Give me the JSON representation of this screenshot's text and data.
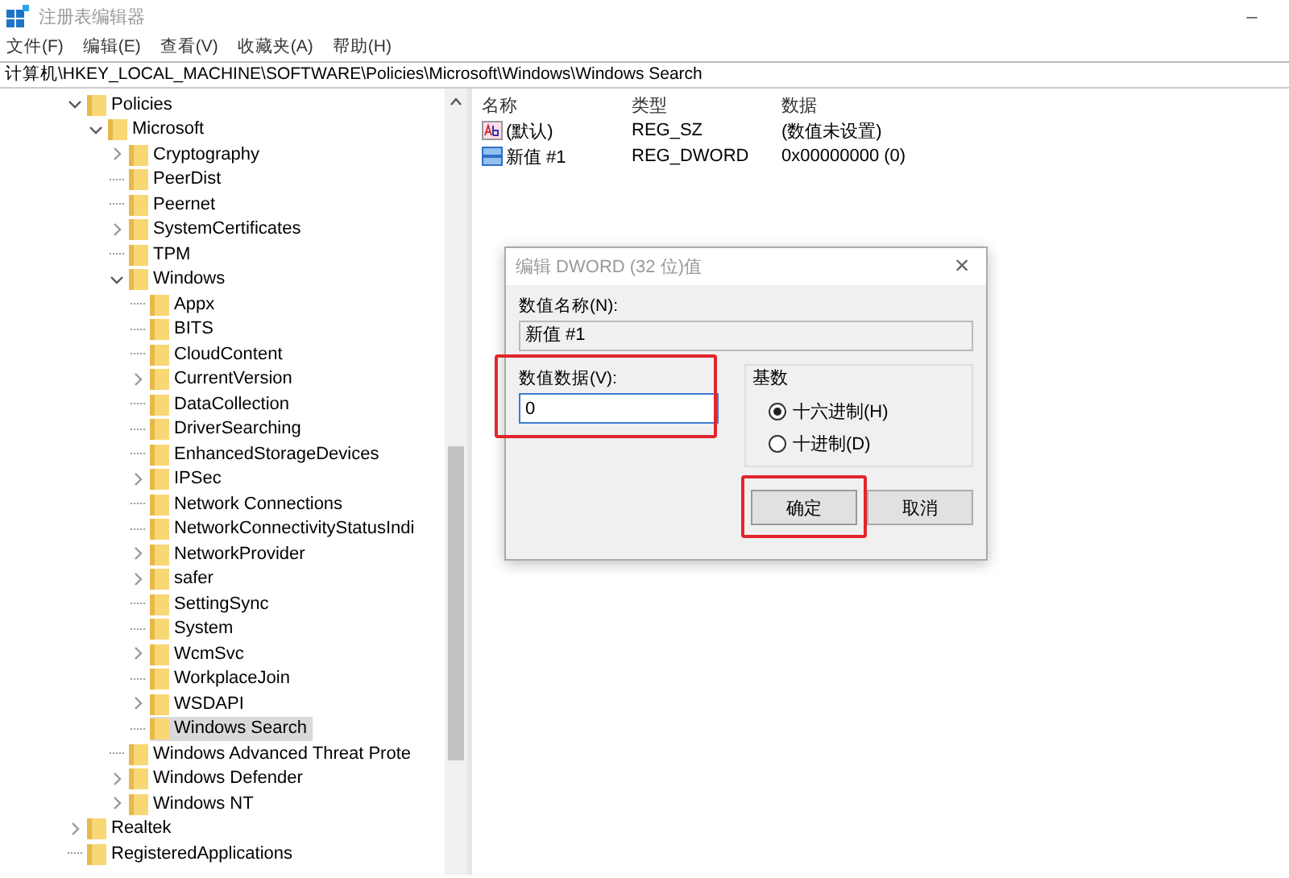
{
  "window": {
    "title": "注册表编辑器",
    "minimize": "–"
  },
  "menu": [
    "文件(F)",
    "编辑(E)",
    "查看(V)",
    "收藏夹(A)",
    "帮助(H)"
  ],
  "address": "计算机\\HKEY_LOCAL_MACHINE\\SOFTWARE\\Policies\\Microsoft\\Windows\\Windows Search",
  "tree": [
    {
      "label": "Policies",
      "kind": "branch",
      "expanded": true,
      "selected": false,
      "children": [
        {
          "label": "Microsoft",
          "kind": "branch",
          "expanded": true,
          "selected": false,
          "children": [
            {
              "label": "Cryptography",
              "kind": "branch",
              "expanded": false,
              "selected": false
            },
            {
              "label": "PeerDist",
              "kind": "leaf",
              "selected": false
            },
            {
              "label": "Peernet",
              "kind": "leaf",
              "selected": false
            },
            {
              "label": "SystemCertificates",
              "kind": "branch",
              "expanded": false,
              "selected": false
            },
            {
              "label": "TPM",
              "kind": "leaf",
              "selected": false
            },
            {
              "label": "Windows",
              "kind": "branch",
              "expanded": true,
              "selected": false,
              "children": [
                {
                  "label": "Appx",
                  "kind": "leaf",
                  "selected": false
                },
                {
                  "label": "BITS",
                  "kind": "leaf",
                  "selected": false
                },
                {
                  "label": "CloudContent",
                  "kind": "leaf",
                  "selected": false
                },
                {
                  "label": "CurrentVersion",
                  "kind": "branch",
                  "expanded": false,
                  "selected": false
                },
                {
                  "label": "DataCollection",
                  "kind": "leaf",
                  "selected": false
                },
                {
                  "label": "DriverSearching",
                  "kind": "leaf",
                  "selected": false
                },
                {
                  "label": "EnhancedStorageDevices",
                  "kind": "leaf",
                  "selected": false
                },
                {
                  "label": "IPSec",
                  "kind": "branch",
                  "expanded": false,
                  "selected": false
                },
                {
                  "label": "Network Connections",
                  "kind": "leaf",
                  "selected": false
                },
                {
                  "label": "NetworkConnectivityStatusIndi",
                  "kind": "leaf",
                  "selected": false
                },
                {
                  "label": "NetworkProvider",
                  "kind": "branch",
                  "expanded": false,
                  "selected": false
                },
                {
                  "label": "safer",
                  "kind": "branch",
                  "expanded": false,
                  "selected": false
                },
                {
                  "label": "SettingSync",
                  "kind": "leaf",
                  "selected": false
                },
                {
                  "label": "System",
                  "kind": "leaf",
                  "selected": false
                },
                {
                  "label": "WcmSvc",
                  "kind": "branch",
                  "expanded": false,
                  "selected": false
                },
                {
                  "label": "WorkplaceJoin",
                  "kind": "leaf",
                  "selected": false
                },
                {
                  "label": "WSDAPI",
                  "kind": "branch",
                  "expanded": false,
                  "selected": false
                },
                {
                  "label": "Windows Search",
                  "kind": "leaf",
                  "selected": true
                }
              ]
            },
            {
              "label": "Windows Advanced Threat Prote",
              "kind": "leaf",
              "selected": false
            },
            {
              "label": "Windows Defender",
              "kind": "branch",
              "expanded": false,
              "selected": false
            },
            {
              "label": "Windows NT",
              "kind": "branch",
              "expanded": false,
              "selected": false
            }
          ]
        }
      ]
    },
    {
      "label": "Realtek",
      "kind": "branch",
      "expanded": false,
      "selected": false
    },
    {
      "label": "RegisteredApplications",
      "kind": "leaf",
      "selected": false
    }
  ],
  "list": {
    "columns": [
      "名称",
      "类型",
      "数据"
    ],
    "rows": [
      {
        "kind": "string",
        "name": "(默认)",
        "type": "REG_SZ",
        "data": "(数值未设置)"
      },
      {
        "kind": "binary",
        "name": "新值 #1",
        "type": "REG_DWORD",
        "data": "0x00000000 (0)"
      }
    ]
  },
  "dialog": {
    "title": "编辑 DWORD (32 位)值",
    "close": "×",
    "name_label": "数值名称(N):",
    "name_value": "新值 #1",
    "data_label": "数值数据(V):",
    "data_value": "0",
    "base_label": "基数",
    "bases": [
      {
        "label": "十六进制(H)",
        "selected": true
      },
      {
        "label": "十进制(D)",
        "selected": false
      }
    ],
    "buttons": [
      {
        "label": "确定",
        "highlighted": true
      },
      {
        "label": "取消",
        "highlighted": false
      }
    ],
    "data_highlighted": true
  }
}
